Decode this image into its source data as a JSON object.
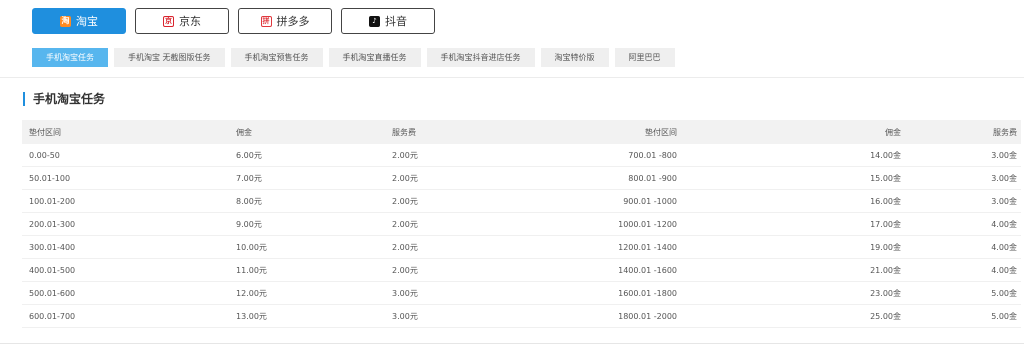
{
  "platform_tabs": [
    {
      "label": "淘宝",
      "icon": "taobao-icon",
      "active": true
    },
    {
      "label": "京东",
      "icon": "jd-icon",
      "active": false
    },
    {
      "label": "拼多多",
      "icon": "pinduoduo-icon",
      "active": false
    },
    {
      "label": "抖音",
      "icon": "douyin-icon",
      "active": false
    }
  ],
  "sub_tabs": [
    {
      "label": "手机淘宝任务",
      "active": true
    },
    {
      "label": "手机淘宝 无截图版任务",
      "active": false
    },
    {
      "label": "手机淘宝预售任务",
      "active": false
    },
    {
      "label": "手机淘宝直播任务",
      "active": false
    },
    {
      "label": "手机淘宝抖音进店任务",
      "active": false
    },
    {
      "label": "淘宝特价版",
      "active": false
    },
    {
      "label": "阿里巴巴",
      "active": false
    }
  ],
  "section": {
    "title": "手机淘宝任务"
  },
  "table": {
    "headers": [
      "垫付区间",
      "佣金",
      "服务费",
      "垫付区间",
      "佣金",
      "服务费"
    ],
    "rows": [
      [
        "0.00-50",
        "6.00元",
        "2.00元",
        "700.01 -800",
        "14.00金",
        "3.00金"
      ],
      [
        "50.01-100",
        "7.00元",
        "2.00元",
        "800.01 -900",
        "15.00金",
        "3.00金"
      ],
      [
        "100.01-200",
        "8.00元",
        "2.00元",
        "900.01 -1000",
        "16.00金",
        "3.00金"
      ],
      [
        "200.01-300",
        "9.00元",
        "2.00元",
        "1000.01 -1200",
        "17.00金",
        "4.00金"
      ],
      [
        "300.01-400",
        "10.00元",
        "2.00元",
        "1200.01 -1400",
        "19.00金",
        "4.00金"
      ],
      [
        "400.01-500",
        "11.00元",
        "2.00元",
        "1400.01 -1600",
        "21.00金",
        "4.00金"
      ],
      [
        "500.01-600",
        "12.00元",
        "3.00元",
        "1600.01 -1800",
        "23.00金",
        "5.00金"
      ],
      [
        "600.01-700",
        "13.00元",
        "3.00元",
        "1800.01 -2000",
        "25.00金",
        "5.00金"
      ]
    ]
  },
  "colors": {
    "accent": "#1f8fde",
    "sub_tab_active": "#57b6ee",
    "header_bg": "#f2f2f2"
  }
}
